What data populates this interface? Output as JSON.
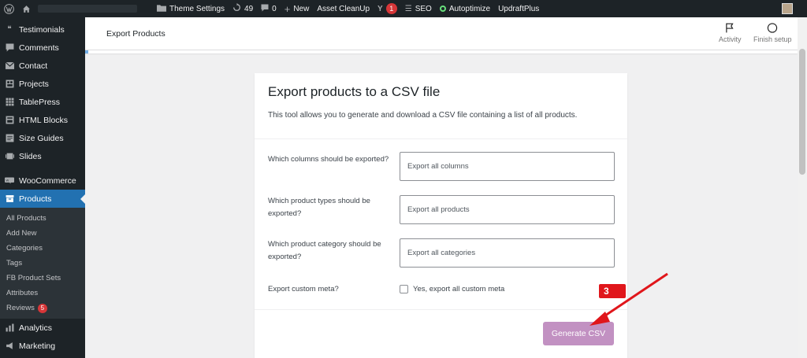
{
  "adminbar": {
    "theme_settings": "Theme Settings",
    "updates_count": "49",
    "comments_count": "0",
    "new_label": "New",
    "asset_cleanup": "Asset CleanUp",
    "yoast_badge": "1",
    "seo_label": "SEO",
    "autoptimize": "Autoptimize",
    "updraftplus": "UpdraftPlus"
  },
  "sidebar": {
    "items_top": [
      {
        "label": "Testimonials",
        "icon": "quote-icon"
      },
      {
        "label": "Comments",
        "icon": "comment-icon"
      },
      {
        "label": "Contact",
        "icon": "mail-icon"
      },
      {
        "label": "Projects",
        "icon": "portfolio-icon"
      },
      {
        "label": "TablePress",
        "icon": "table-icon"
      },
      {
        "label": "HTML Blocks",
        "icon": "blocks-icon"
      },
      {
        "label": "Size Guides",
        "icon": "guide-icon"
      },
      {
        "label": "Slides",
        "icon": "slides-icon"
      }
    ],
    "woocommerce": "WooCommerce",
    "products": "Products",
    "submenu": [
      "All Products",
      "Add New",
      "Categories",
      "Tags",
      "FB Product Sets",
      "Attributes",
      "Reviews"
    ],
    "reviews_count": "5",
    "analytics": "Analytics",
    "marketing": "Marketing"
  },
  "header": {
    "title": "Export Products",
    "activity": "Activity",
    "finish_setup": "Finish setup"
  },
  "card": {
    "title": "Export products to a CSV file",
    "description": "This tool allows you to generate and download a CSV file containing a list of all products.",
    "rows": [
      {
        "label": "Which columns should be exported?",
        "value": "Export all columns"
      },
      {
        "label": "Which product types should be exported?",
        "value": "Export all products"
      },
      {
        "label": "Which product category should be exported?",
        "value": "Export all categories"
      }
    ],
    "custom_meta_label": "Export custom meta?",
    "custom_meta_checkbox": "Yes, export all custom meta",
    "generate_button": "Generate CSV"
  },
  "annotation": {
    "step": "3",
    "color": "#e0161b"
  }
}
